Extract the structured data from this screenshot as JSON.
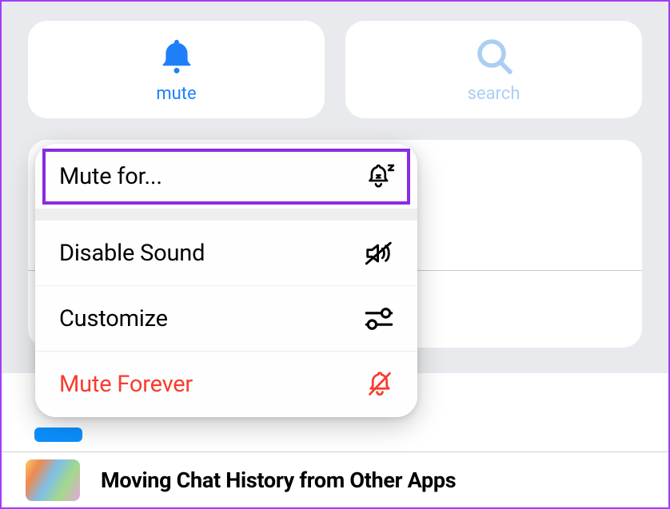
{
  "actions": {
    "mute": {
      "label": "mute"
    },
    "search": {
      "label": "search"
    }
  },
  "mute_menu": {
    "mute_for": {
      "label": "Mute for..."
    },
    "disable_sound": {
      "label": "Disable Sound"
    },
    "customize": {
      "label": "Customize"
    },
    "mute_forever": {
      "label": "Mute Forever"
    }
  },
  "chat_list": {
    "item_title": "Moving Chat History from Other Apps"
  },
  "colors": {
    "accent": "#1f7ff9",
    "danger": "#fa3b2f",
    "highlight": "#8a2be2"
  }
}
